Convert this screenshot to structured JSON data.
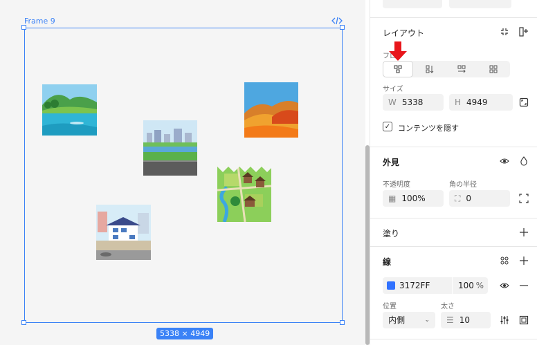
{
  "canvas": {
    "frame_label": "Frame 9",
    "size_badge": "5338 × 4949",
    "thumbnails": [
      {
        "name": "lake-landscape-thumb"
      },
      {
        "name": "river-city-thumb"
      },
      {
        "name": "autumn-mountain-thumb"
      },
      {
        "name": "village-map-thumb"
      },
      {
        "name": "townhouse-thumb"
      }
    ]
  },
  "panel": {
    "layout": {
      "title": "レイアウト",
      "flow_label": "フロ",
      "size_label": "サイズ",
      "w_prefix": "W",
      "w_value": "5338",
      "h_prefix": "H",
      "h_value": "4949",
      "clip_label": "コンテンツを隠す",
      "clip_checked": "✓"
    },
    "appearance": {
      "title": "外見",
      "opacity_label": "不透明度",
      "opacity_value": "100%",
      "radius_label": "角の半径",
      "radius_value": "0"
    },
    "fill": {
      "title": "塗り"
    },
    "stroke": {
      "title": "線",
      "color_hex": "3172FF",
      "color_swatch": "#3172ff",
      "opacity_value": "100",
      "opacity_unit": "%",
      "position_label": "位置",
      "position_value": "内側",
      "weight_label": "太さ",
      "weight_value": "10"
    }
  },
  "colors": {
    "accent": "#3b82f6",
    "arrow": "#e8161b"
  }
}
